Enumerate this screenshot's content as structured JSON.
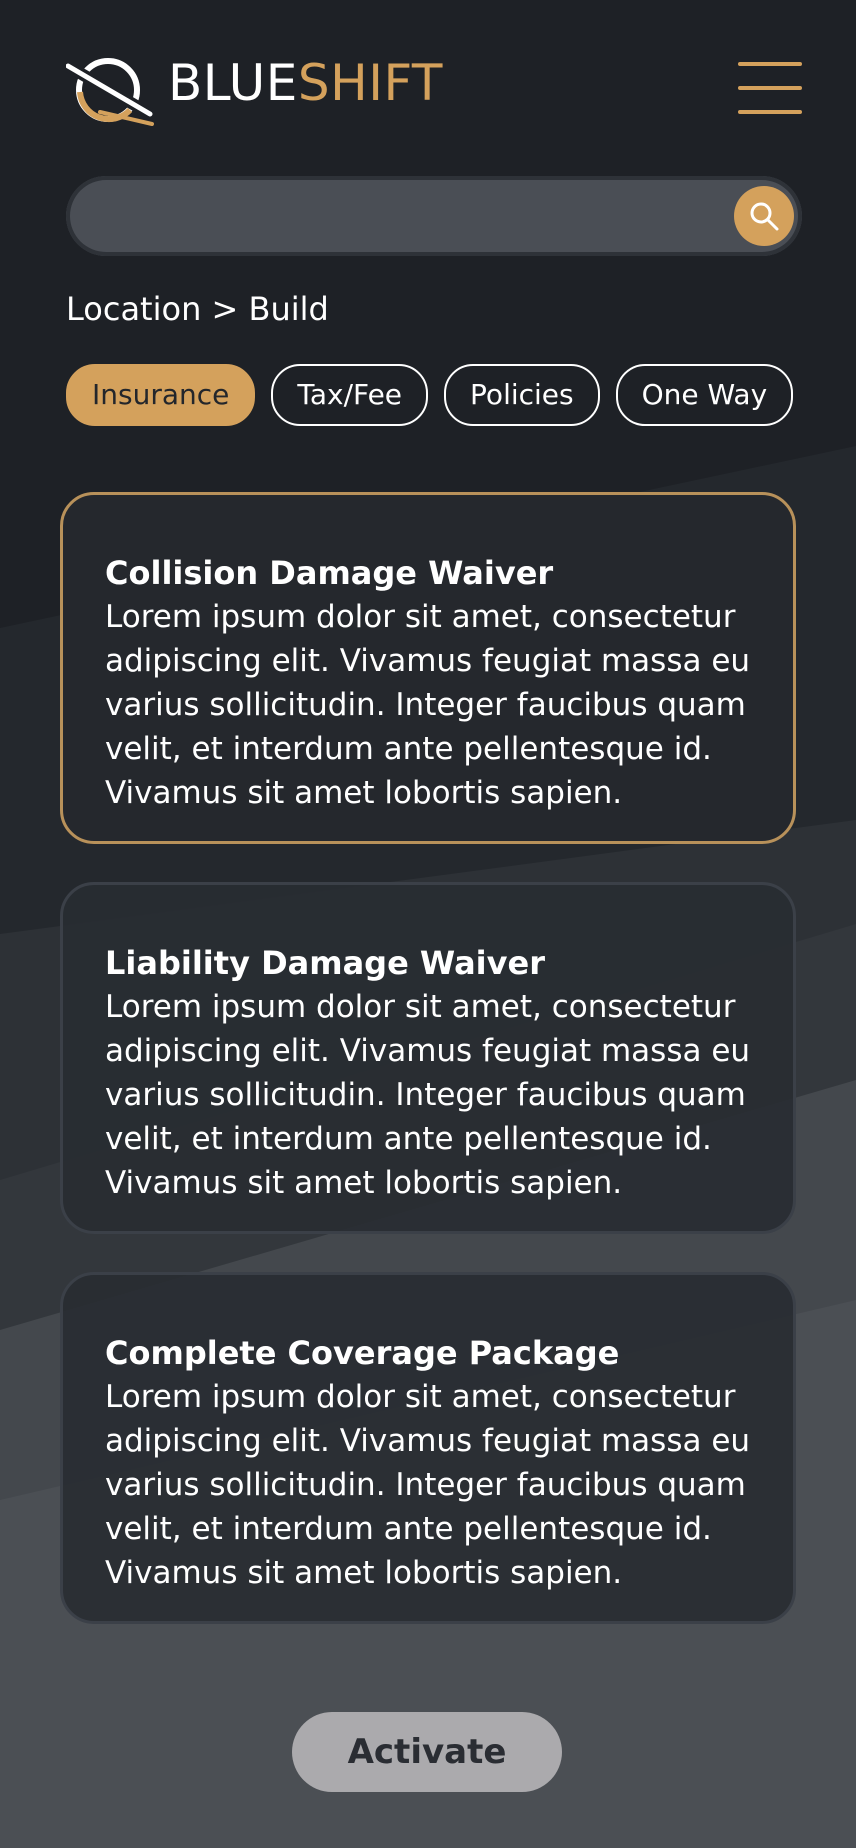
{
  "brand": {
    "name_part1": "BLUE",
    "name_part2": "SHIFT"
  },
  "search": {
    "value": "",
    "placeholder": ""
  },
  "breadcrumb": "Location > Build",
  "tabs": [
    {
      "label": "Insurance",
      "active": true
    },
    {
      "label": "Tax/Fee",
      "active": false
    },
    {
      "label": "Policies",
      "active": false
    },
    {
      "label": "One Way",
      "active": false
    }
  ],
  "cards": [
    {
      "title": "Collision Damage Waiver",
      "description": "Lorem ipsum dolor sit amet, consectetur adipiscing elit. Vivamus feugiat massa eu varius sollicitudin. Integer faucibus quam velit, et interdum ante pellentesque id. Vivamus sit amet lobortis sapien.",
      "selected": true
    },
    {
      "title": "Liability Damage Waiver",
      "description": "Lorem ipsum dolor sit amet, consectetur adipiscing elit. Vivamus feugiat massa eu varius sollicitudin. Integer faucibus quam velit, et interdum ante pellentesque id. Vivamus sit amet lobortis sapien.",
      "selected": false
    },
    {
      "title": "Complete Coverage Package",
      "description": "Lorem ipsum dolor sit amet, consectetur adipiscing elit. Vivamus feugiat massa eu varius sollicitudin. Integer faucibus quam velit, et interdum ante pellentesque id. Vivamus sit amet lobortis sapien.",
      "selected": false
    }
  ],
  "actions": {
    "activate_label": "Activate"
  },
  "icons": {
    "logo": "ring-logo-icon",
    "menu": "hamburger-menu-icon",
    "search": "search-icon"
  },
  "colors": {
    "accent": "#d4a15c",
    "background": "#1e2126",
    "card_selected_border": "#b8915a",
    "button": "#abaaad"
  }
}
